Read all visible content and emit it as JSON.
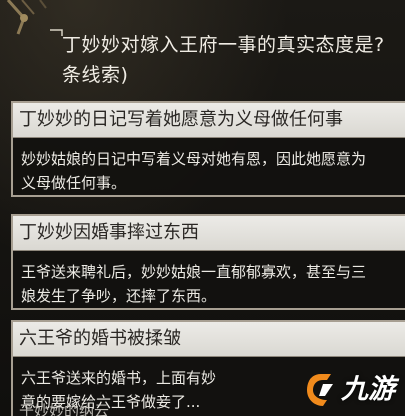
{
  "question": {
    "line1": "丁妙妙对嫁入王府一事的真实态度是?",
    "line2": "条线索)"
  },
  "clues": [
    {
      "title": "丁妙妙的日记写着她愿意为义母做任何事",
      "body": [
        "妙妙姑娘的日记中写着义母对她有恩，因此她愿意为",
        "义母做任何事。"
      ]
    },
    {
      "title": "丁妙妙因婚事摔过东西",
      "body": [
        "王爷送来聘礼后，妙妙姑娘一直郁郁寡欢，甚至与三",
        "娘发生了争吵，还摔了东西。"
      ]
    },
    {
      "title": "六王爷的婚书被揉皱",
      "body": [
        "六王爷送来的婚书，上面有妙",
        "意的要嫁给六王爷做妾了..."
      ]
    }
  ],
  "partial_text": "于妙妙的纳云",
  "watermark": {
    "text": "九游",
    "colors": {
      "orange": "#f08a1c",
      "white": "#ffffff"
    }
  }
}
